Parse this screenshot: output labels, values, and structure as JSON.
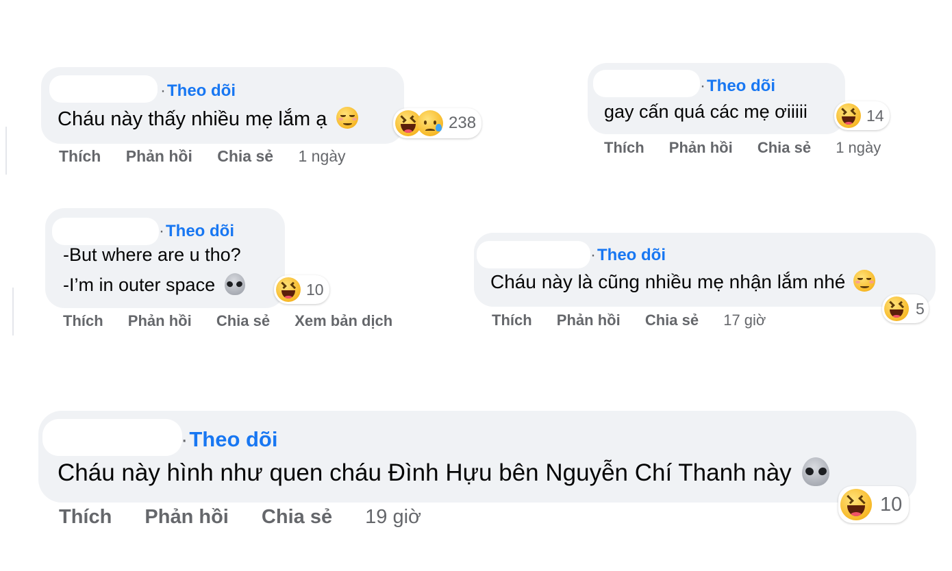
{
  "comments": [
    {
      "follow_label": "Theo dõi",
      "text": "Cháu này thấy nhiều mẹ lắm ạ",
      "reaction_count": "238",
      "actions": {
        "like": "Thích",
        "reply": "Phản hồi",
        "share": "Chia sẻ"
      },
      "time": "1 ngày"
    },
    {
      "follow_label": "Theo dõi",
      "text": "gay cấn quá các mẹ ơiiiii",
      "reaction_count": "14",
      "actions": {
        "like": "Thích",
        "reply": "Phản hồi",
        "share": "Chia sẻ"
      },
      "time": "1 ngày"
    },
    {
      "follow_label": "Theo dõi",
      "text_line1": "-But where are u tho?",
      "text_line2": "-I’m in outer space",
      "reaction_count": "10",
      "actions": {
        "like": "Thích",
        "reply": "Phản hồi",
        "share": "Chia sẻ",
        "translate": "Xem bản dịch"
      }
    },
    {
      "follow_label": "Theo dõi",
      "text": "Cháu này là cũng nhiều mẹ nhận lắm nhé",
      "reaction_count": "5",
      "actions": {
        "like": "Thích",
        "reply": "Phản hồi",
        "share": "Chia sẻ"
      },
      "time": "17 giờ"
    },
    {
      "follow_label": "Theo dõi",
      "text": "Cháu này hình như quen cháu Đình Hựu bên Nguyễn Chí Thanh này",
      "reaction_count": "10",
      "actions": {
        "like": "Thích",
        "reply": "Phản hồi",
        "share": "Chia sẻ"
      },
      "time": "19 giờ"
    }
  ],
  "colors": {
    "bubble": "#f0f2f5",
    "link_blue": "#1877f2",
    "secondary_text": "#65676b",
    "primary_text": "#050505"
  },
  "icons": [
    "haha-reaction-icon",
    "sad-reaction-icon",
    "blush-emoji-icon",
    "alien-emoji-icon"
  ]
}
